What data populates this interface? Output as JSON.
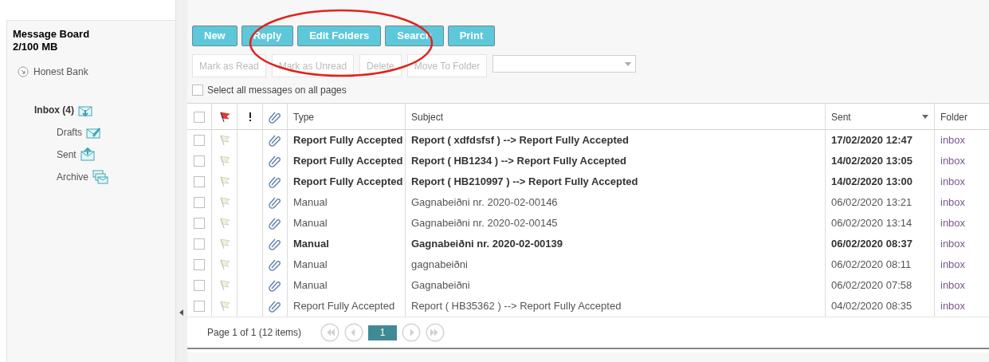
{
  "sidebar": {
    "title": "Message Board",
    "quota": "2/100 MB",
    "account": "Honest Bank",
    "folders": [
      {
        "label": "Inbox (4)",
        "kind": "inbox",
        "unread": true
      },
      {
        "label": "Drafts",
        "kind": "drafts",
        "unread": false
      },
      {
        "label": "Sent",
        "kind": "sent",
        "unread": false
      },
      {
        "label": "Archive",
        "kind": "archive",
        "unread": false
      }
    ]
  },
  "toolbar": {
    "buttons": [
      "New",
      "Reply",
      "Edit Folders",
      "Search",
      "Print"
    ],
    "actions": [
      {
        "label": "Mark as Read",
        "disabled": true
      },
      {
        "label": "Mark as Unread",
        "disabled": true
      },
      {
        "label": "Delete",
        "disabled": true
      },
      {
        "label": "Move To Folder",
        "disabled": true
      }
    ],
    "select_all": {
      "label": "Select all messages on all pages",
      "checked": false
    }
  },
  "table": {
    "header_checked": false,
    "columns": [
      "Type",
      "Subject",
      "Sent",
      "Folder"
    ],
    "rows": [
      {
        "checked": false,
        "unread": true,
        "type": "Report Fully Accepted",
        "subject": "Report ( xdfdsfsf ) --> Report Fully Accepted",
        "sent": "17/02/2020 12:47",
        "folder": "inbox"
      },
      {
        "checked": false,
        "unread": true,
        "type": "Report Fully Accepted",
        "subject": "Report ( HB1234 ) --> Report Fully Accepted",
        "sent": "14/02/2020 13:05",
        "folder": "inbox"
      },
      {
        "checked": false,
        "unread": true,
        "type": "Report Fully Accepted",
        "subject": "Report ( HB210997 ) --> Report Fully Accepted",
        "sent": "14/02/2020 13:00",
        "folder": "inbox"
      },
      {
        "checked": false,
        "unread": false,
        "type": "Manual",
        "subject": "Gagnabeiðni nr. 2020-02-00146",
        "sent": "06/02/2020 13:21",
        "folder": "inbox"
      },
      {
        "checked": false,
        "unread": false,
        "type": "Manual",
        "subject": "Gagnabeiðni nr. 2020-02-00145",
        "sent": "06/02/2020 13:14",
        "folder": "inbox"
      },
      {
        "checked": false,
        "unread": true,
        "type": "Manual",
        "subject": "Gagnabeiðni nr. 2020-02-00139",
        "sent": "06/02/2020 08:37",
        "folder": "inbox"
      },
      {
        "checked": false,
        "unread": false,
        "type": "Manual",
        "subject": "gagnabeiðni",
        "sent": "06/02/2020 08:11",
        "folder": "inbox"
      },
      {
        "checked": false,
        "unread": false,
        "type": "Manual",
        "subject": "Gagnabeiðni",
        "sent": "06/02/2020 07:58",
        "folder": "inbox"
      },
      {
        "checked": false,
        "unread": false,
        "type": "Report Fully Accepted",
        "subject": "Report ( HB35362 ) --> Report Fully Accepted",
        "sent": "04/02/2020 08:35",
        "folder": "inbox"
      }
    ]
  },
  "pager": {
    "summary": "Page 1 of 1 (12 items)",
    "pages": [
      {
        "label": "1",
        "selected": true
      }
    ]
  }
}
